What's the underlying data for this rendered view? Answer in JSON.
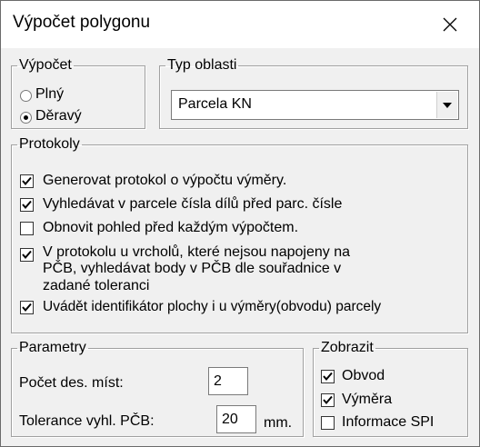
{
  "window": {
    "title": "Výpočet polygonu"
  },
  "calc": {
    "legend": "Výpočet",
    "options": [
      {
        "label": "Plný",
        "selected": false
      },
      {
        "label": "Děravý",
        "selected": true
      }
    ]
  },
  "area_type": {
    "legend": "Typ oblasti",
    "value": "Parcela KN"
  },
  "protocols": {
    "legend": "Protokoly",
    "items": [
      {
        "lines": [
          "Generovat protokol o výpočtu výměry."
        ],
        "checked": true
      },
      {
        "lines": [
          "Vyhledávat v parcele čísla dílů před parc. čísle"
        ],
        "checked": true
      },
      {
        "lines": [
          "Obnovit pohled před každým výpočtem."
        ],
        "checked": false
      },
      {
        "lines": [
          "V protokolu u vrcholů, které nejsou napojeny na",
          "PČB, vyhledávat body v PČB dle souřadnice v",
          "zadané toleranci"
        ],
        "checked": true
      },
      {
        "lines": [
          "Uvádět identifikátor plochy i u výměry(obvodu) parcely"
        ],
        "checked": true
      }
    ]
  },
  "params": {
    "legend": "Parametry",
    "decimals_label": "Počet des. míst:",
    "decimals_value": "2",
    "tolerance_label": "Tolerance vyhl. PČB:",
    "tolerance_value": "20",
    "tolerance_unit": "mm."
  },
  "display": {
    "legend": "Zobrazit",
    "items": [
      {
        "label": "Obvod",
        "checked": true
      },
      {
        "label": "Výměra",
        "checked": true
      },
      {
        "label": "Informace SPI",
        "checked": false
      }
    ]
  }
}
